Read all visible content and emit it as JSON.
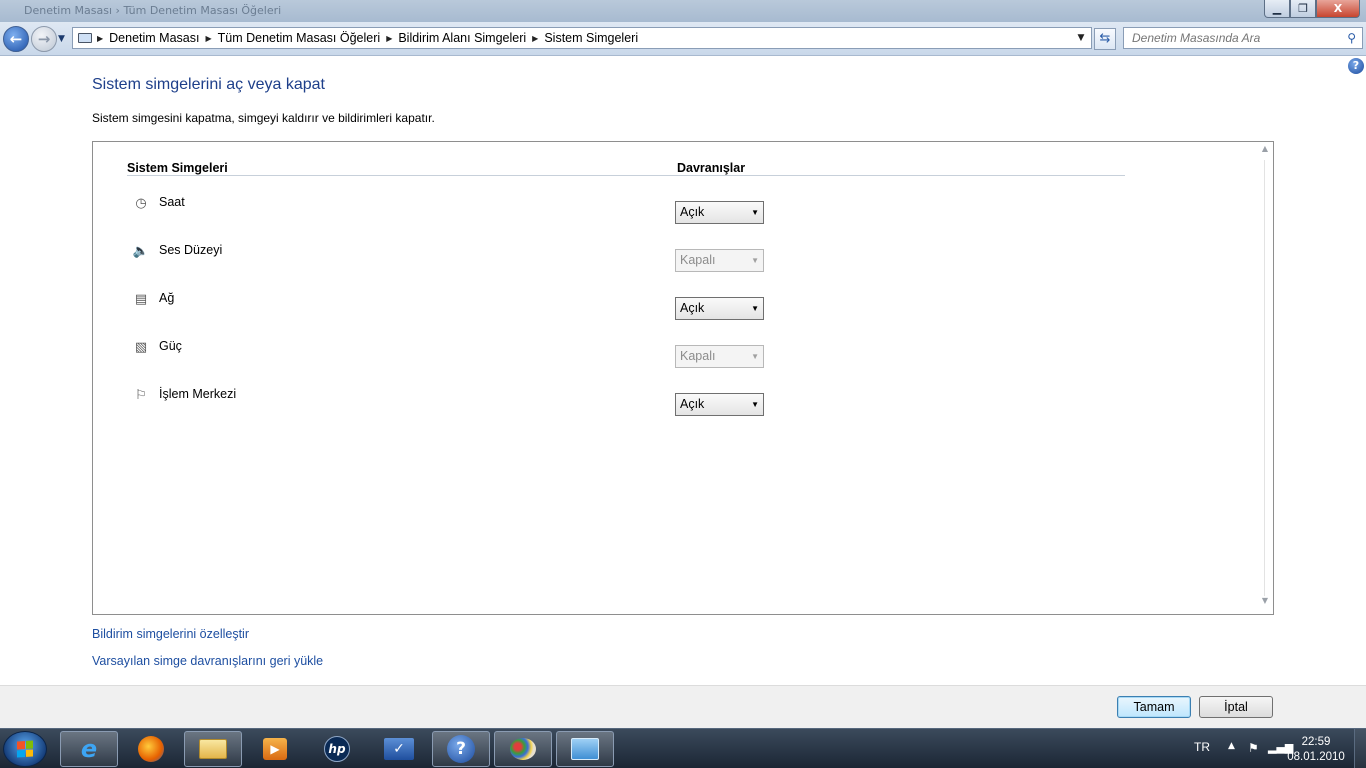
{
  "window": {
    "title": "Denetim Masası › Tüm Denetim Masası Öğeleri",
    "controls": {
      "minimize": "▁",
      "maximize": "❐",
      "close": "X"
    }
  },
  "nav": {
    "breadcrumb": [
      "Denetim Masası",
      "Tüm Denetim Masası Öğeleri",
      "Bildirim Alanı Simgeleri",
      "Sistem Simgeleri"
    ],
    "search_placeholder": "Denetim Masasında Ara"
  },
  "page": {
    "title": "Sistem simgelerini aç veya kapat",
    "description": "Sistem simgesini kapatma, simgeyi kaldırır ve bildirimleri kapatır."
  },
  "table": {
    "col_icons": "Sistem Simgeleri",
    "col_behaviors": "Davranışlar",
    "rows": [
      {
        "label": "Saat",
        "icon": "clock-icon",
        "value": "Açık",
        "enabled": true
      },
      {
        "label": "Ses Düzeyi",
        "icon": "speaker-icon",
        "value": "Kapalı",
        "enabled": false
      },
      {
        "label": "Ağ",
        "icon": "network-icon",
        "value": "Açık",
        "enabled": true
      },
      {
        "label": "Güç",
        "icon": "power-icon",
        "value": "Kapalı",
        "enabled": false
      },
      {
        "label": "İşlem Merkezi",
        "icon": "action-center-flag-icon",
        "value": "Açık",
        "enabled": true
      }
    ]
  },
  "links": {
    "customize": "Bildirim simgelerini özelleştir",
    "restore": "Varsayılan simge davranışlarını geri yükle"
  },
  "buttons": {
    "ok": "Tamam",
    "cancel": "İptal"
  },
  "taskbar": {
    "apps": [
      "internet-explorer-icon",
      "firefox-icon",
      "explorer-folder-icon",
      "media-player-icon",
      "hp-icon",
      "checkmark-app-icon",
      "help-icon",
      "paint-icon",
      "control-panel-icon"
    ],
    "tray": {
      "language": "TR",
      "time": "22:59",
      "date": "08.01.2010"
    }
  },
  "colors": {
    "accent": "#1e3f8a",
    "link": "#1e4fa1"
  }
}
